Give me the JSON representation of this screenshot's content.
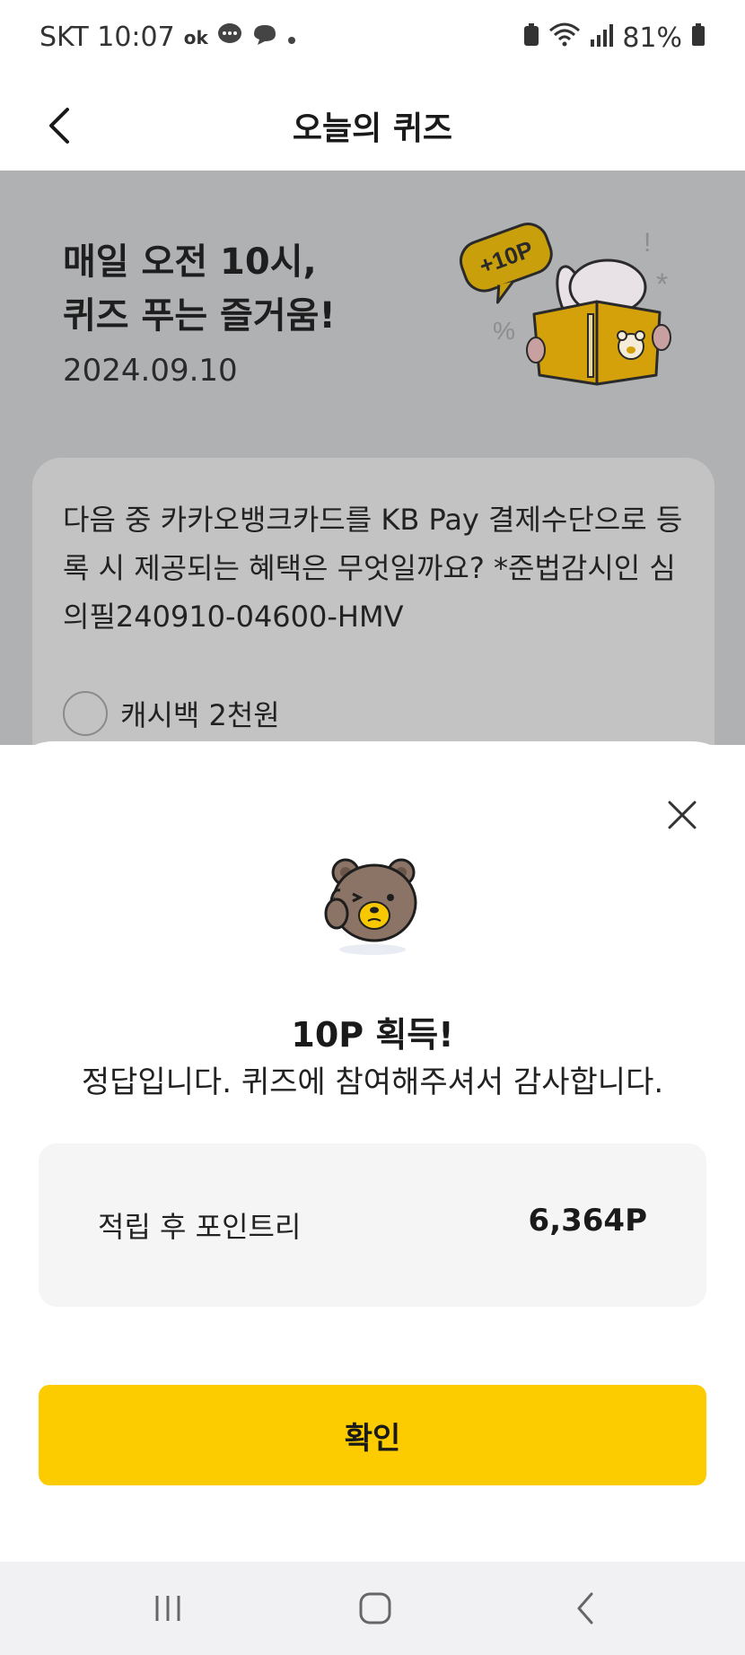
{
  "status_bar": {
    "carrier_time": "SKT 10:07",
    "notif_text": "ok",
    "battery": "81%"
  },
  "header": {
    "title": "오늘의 퀴즈"
  },
  "hero": {
    "title_line1": "매일 오전 10시,",
    "title_line2": "퀴즈 푸는 즐거움!",
    "date": "2024.09.10",
    "badge": "+10P"
  },
  "question": {
    "text": "다음 중 카카오뱅크카드를 KB Pay 결제수단으로 등록 시 제공되는 혜택은 무엇일까요? *준법감시인 심의필240910-04600-HMV",
    "option1": "캐시백 2천원"
  },
  "sheet": {
    "reward_title": "10P 획득!",
    "reward_sub": "정답입니다. 퀴즈에 참여해주셔서 감사합니다.",
    "points_label": "적립 후 포인트리",
    "points_value": "6,364P",
    "confirm_label": "확인"
  },
  "colors": {
    "accent": "#fccc00",
    "dim_bg": "#b0b1b3"
  },
  "icons": [
    "back-icon",
    "close-icon",
    "bear-icon",
    "book-reading-illustration",
    "recents-icon",
    "home-icon",
    "nav-back-icon"
  ]
}
